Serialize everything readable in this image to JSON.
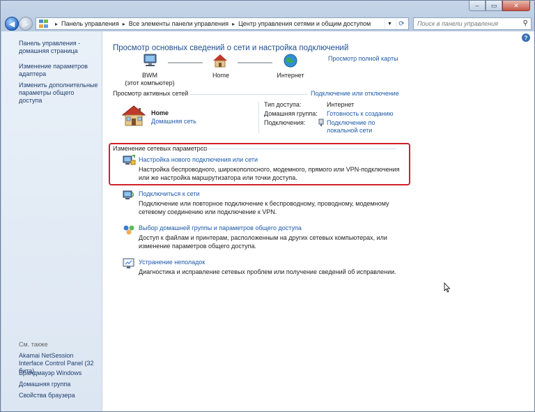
{
  "window": {
    "caption_buttons": {
      "minimize": "‒",
      "maximize": "▭",
      "close": "✕"
    }
  },
  "nav": {
    "back_icon": "back-arrow-icon",
    "forward_icon": "forward-arrow-icon",
    "breadcrumbs": [
      "Панель управления",
      "Все элементы панели управления",
      "Центр управления сетями и общим доступом"
    ],
    "search_placeholder": "Поиск в панели управления"
  },
  "sidebar": {
    "links": [
      "Панель управления - домашняя страница",
      "Изменение параметров адаптера",
      "Изменить дополнительные параметры общего доступа"
    ],
    "see_also_title": "См. также",
    "see_also": [
      "Akamai NetSession Interface Control Panel (32 бита)",
      "Брандмауэр Windows",
      "Домашняя группа",
      "Свойства браузера"
    ]
  },
  "main": {
    "title": "Просмотр основных сведений о сети и настройка подключений",
    "full_map_link": "Просмотр полной карты",
    "map_nodes": [
      {
        "label": "BWM",
        "sublabel": "(этот компьютер)"
      },
      {
        "label": "Home"
      },
      {
        "label": "Интернет"
      }
    ],
    "active_networks_title": "Просмотр активных сетей",
    "connect_disconnect_link": "Подключение или отключение",
    "network": {
      "name": "Home",
      "type_link": "Домашняя сеть",
      "access_type_label": "Тип доступа:",
      "access_type_value": "Интернет",
      "homegroup_label": "Домашняя группа:",
      "homegroup_value": "Готовность к созданию",
      "connections_label": "Подключения:",
      "connections_value": "Подключение по локальной сети"
    },
    "change_settings_title": "Изменение сетевых параметров",
    "tasks": [
      {
        "title": "Настройка нового подключения или сети",
        "desc": "Настройка беспроводного, широкополосного, модемного, прямого или VPN-подключения или же настройка маршрутизатора или точки доступа."
      },
      {
        "title": "Подключиться к сети",
        "desc": "Подключение или повторное подключение к беспроводному, проводному, модемному сетевому соединению или подключение к VPN."
      },
      {
        "title": "Выбор домашней группы и параметров общего доступа",
        "desc": "Доступ к файлам и принтерам, расположенным на других сетевых компьютерах, или изменение параметров общего доступа."
      },
      {
        "title": "Устранение неполадок",
        "desc": "Диагностика и исправление сетевых проблем или получение сведений об исправлении."
      }
    ]
  },
  "colors": {
    "link": "#1d5aa8",
    "title": "#1f4e92",
    "highlight_box": "#d3202a"
  }
}
